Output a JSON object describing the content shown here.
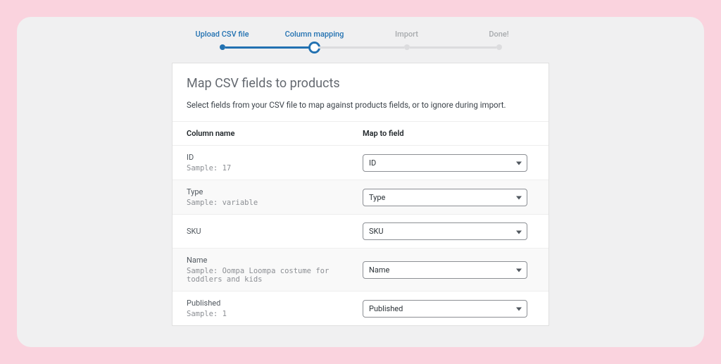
{
  "stepper": {
    "steps": [
      {
        "label": "Upload CSV file",
        "state": "done"
      },
      {
        "label": "Column mapping",
        "state": "active"
      },
      {
        "label": "Import",
        "state": "future"
      },
      {
        "label": "Done!",
        "state": "future"
      }
    ]
  },
  "panel": {
    "title": "Map CSV fields to products",
    "description": "Select fields from your CSV file to map against products fields, or to ignore during import."
  },
  "table": {
    "header_column": "Column name",
    "header_map": "Map to field",
    "sample_prefix": "Sample: ",
    "rows": [
      {
        "name": "ID",
        "sample": "17",
        "selected": "ID"
      },
      {
        "name": "Type",
        "sample": "variable",
        "selected": "Type"
      },
      {
        "name": "SKU",
        "sample": "",
        "selected": "SKU"
      },
      {
        "name": "Name",
        "sample": "Oompa Loompa costume for toddlers and kids",
        "selected": "Name"
      },
      {
        "name": "Published",
        "sample": "1",
        "selected": "Published"
      }
    ]
  }
}
